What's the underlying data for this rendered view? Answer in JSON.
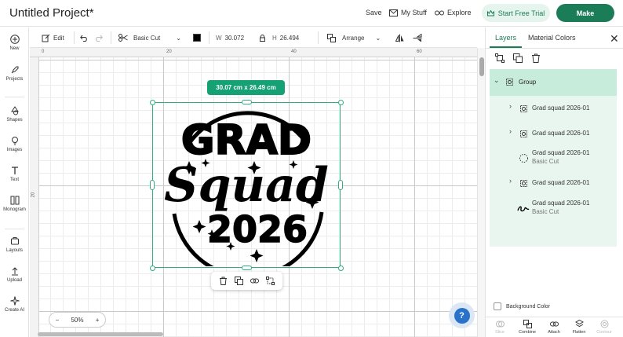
{
  "header": {
    "project_title": "Untitled Project*",
    "save_label": "Save",
    "my_stuff_label": "My Stuff",
    "explore_label": "Explore",
    "trial_label": "Start Free Trial",
    "make_label": "Make"
  },
  "left_nav": {
    "items": [
      {
        "label": "New",
        "icon": "plus-circle-icon"
      },
      {
        "label": "Projects",
        "icon": "rocket-icon"
      },
      {
        "label": "Shapes",
        "icon": "shapes-icon"
      },
      {
        "label": "Images",
        "icon": "lightbulb-icon"
      },
      {
        "label": "Text",
        "icon": "text-t-icon"
      },
      {
        "label": "Monogram",
        "icon": "monogram-icon"
      },
      {
        "label": "Layouts",
        "icon": "layouts-icon"
      },
      {
        "label": "Upload",
        "icon": "upload-icon"
      },
      {
        "label": "Create AI",
        "icon": "sparkle-icon"
      }
    ]
  },
  "toolbar": {
    "edit_label": "Edit",
    "operation_label": "Basic Cut",
    "color_swatch": "#000000",
    "width_label": "W",
    "width_value": "30.072",
    "height_label": "H",
    "height_value": "26.494",
    "arrange_label": "Arrange"
  },
  "canvas": {
    "ruler_top_ticks": [
      "0",
      "20",
      "40",
      "60"
    ],
    "ruler_left_ticks": [
      "20"
    ],
    "size_badge": "30.07 cm x 26.49 cm",
    "zoom_value": "50%",
    "zoom_minus": "−",
    "zoom_plus": "+",
    "help_symbol": "?",
    "artwork_text": {
      "line1": "GRAD",
      "line2": "Squad",
      "line3": "2026"
    }
  },
  "panel": {
    "tab_layers": "Layers",
    "tab_material_colors": "Material Colors",
    "close_symbol": "✕",
    "group_label": "Group",
    "layers": [
      {
        "name": "Grad squad 2026-01",
        "sub": "",
        "expandable": true,
        "icon": "group-icon"
      },
      {
        "name": "Grad squad 2026-01",
        "sub": "",
        "expandable": true,
        "icon": "group-icon"
      },
      {
        "name": "Grad squad 2026-01",
        "sub": "Basic Cut",
        "expandable": false,
        "icon": "circle-dashed-icon"
      },
      {
        "name": "Grad squad 2026-01",
        "sub": "",
        "expandable": true,
        "icon": "group-icon"
      },
      {
        "name": "Grad squad 2026-01",
        "sub": "Basic Cut",
        "expandable": false,
        "icon": "squad-thumbnail-icon"
      }
    ],
    "background_color_label": "Background Color",
    "bottom_actions": [
      {
        "label": "Slice",
        "enabled": false
      },
      {
        "label": "Combine",
        "enabled": true
      },
      {
        "label": "Attach",
        "enabled": true
      },
      {
        "label": "Flatten",
        "enabled": true
      },
      {
        "label": "Contour",
        "enabled": false
      }
    ]
  },
  "colors": {
    "brand_green": "#1b7d57",
    "selection_green": "#2fae7f",
    "badge_green": "#15a173",
    "layer_highlight": "#c8ecdb",
    "help_blue": "#2a72c9"
  }
}
